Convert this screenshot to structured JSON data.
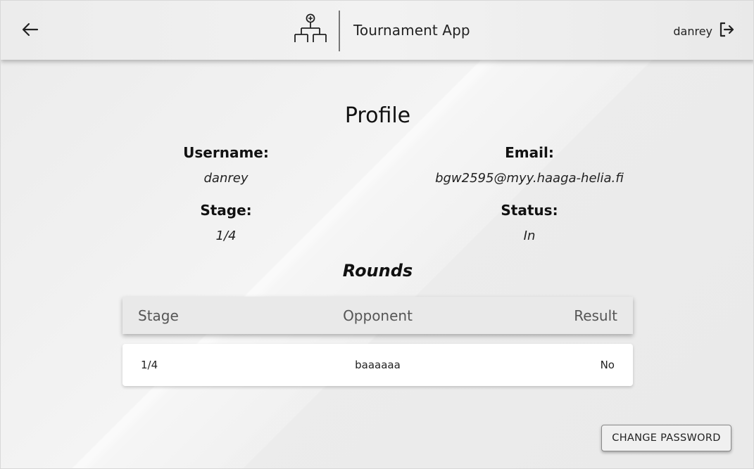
{
  "header": {
    "app_title": "Tournament App",
    "username": "danrey",
    "back_icon": "arrow-left-icon",
    "logo_icon": "tournament-bracket-icon",
    "logout_icon": "logout-icon"
  },
  "profile": {
    "title": "Profile",
    "username_label": "Username:",
    "username_value": "danrey",
    "email_label": "Email:",
    "email_value": "bgw2595@myy.haaga-helia.fi",
    "stage_label": "Stage:",
    "stage_value": "1/4",
    "status_label": "Status:",
    "status_value": "In"
  },
  "rounds": {
    "title": "Rounds",
    "columns": [
      "Stage",
      "Opponent",
      "Result"
    ],
    "rows": [
      {
        "stage": "1/4",
        "opponent": "baaaaaa",
        "result": "No"
      }
    ]
  },
  "actions": {
    "change_password_label": "CHANGE PASSWORD"
  }
}
